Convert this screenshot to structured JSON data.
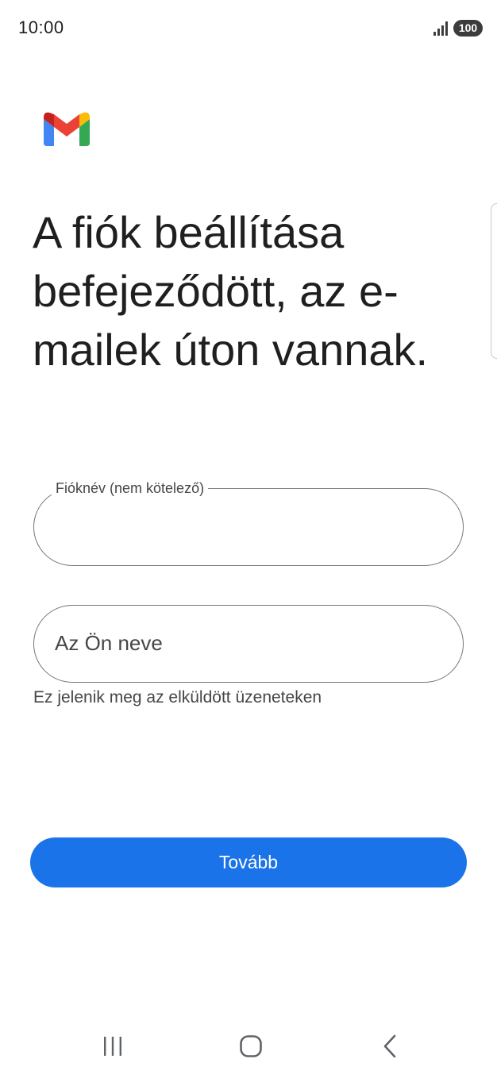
{
  "status_bar": {
    "time": "10:00",
    "battery": "100",
    "icons": [
      "signal-icon",
      "battery-icon"
    ]
  },
  "app": {
    "logo": "gmail-logo",
    "colors": {
      "primary": "#1a73e8",
      "field_border": "#747775",
      "text": "#1f1f1f",
      "secondary_text": "#444746"
    }
  },
  "main": {
    "title": "A fiók beállítása befejeződött, az e-mailek úton vannak.",
    "account_name_field": {
      "label": "Fióknév (nem kötelező)",
      "value": ""
    },
    "your_name_field": {
      "placeholder": "Az Ön neve",
      "value": "",
      "helper": "Ez jelenik meg az elküldött üzeneteken"
    },
    "next_label": "Tovább"
  },
  "nav_bar": {
    "items": [
      "recents-icon",
      "home-icon",
      "back-icon"
    ]
  }
}
